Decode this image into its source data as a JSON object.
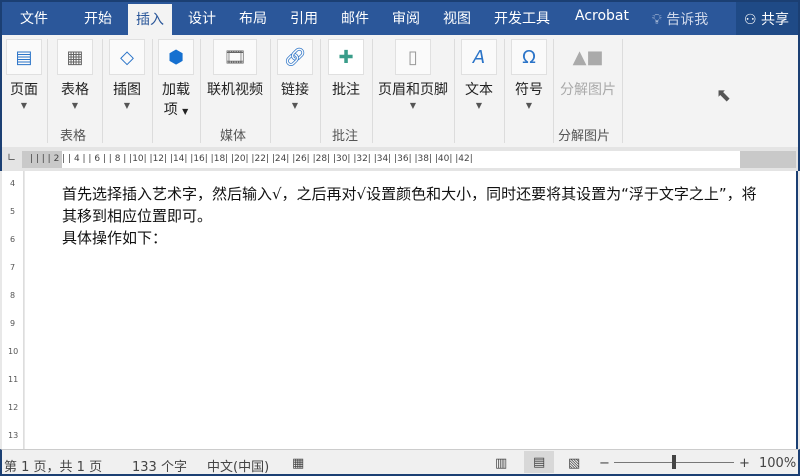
{
  "tabs": [
    "文件",
    "开始",
    "插入",
    "设计",
    "布局",
    "引用",
    "邮件",
    "审阅",
    "视图",
    "开发工具",
    "Acrobat"
  ],
  "tell_me": "告诉我",
  "share": "共享",
  "ribbon": {
    "buttons": [
      {
        "label": "页面"
      },
      {
        "label": "表格"
      },
      {
        "label": "插图"
      },
      {
        "label": "加载",
        "label2": "项"
      },
      {
        "label": "联机视频"
      },
      {
        "label": "链接"
      },
      {
        "label": "批注"
      },
      {
        "label": "页眉和页脚"
      },
      {
        "label": "文本"
      },
      {
        "label": "符号"
      },
      {
        "label": "分解图片"
      }
    ],
    "groups": [
      "表格",
      "媒体",
      "批注",
      "分解图片"
    ]
  },
  "ruler": {
    "ticks": "|   |  |  |  2 |  | 4 |  | 6 |  | 8 |  |10|  |12|  |14|  |16|  |18|  |20|  |22|  |24|  |26|  |28|  |30|  |32|  |34|  |36|  |38|  |40|  |42|"
  },
  "vruler": [
    "4",
    "5",
    "6",
    "7",
    "8",
    "9",
    "10",
    "11",
    "12",
    "13"
  ],
  "document": {
    "lines": [
      "首先选择插入艺术字，然后输入√，之后再对√设置颜色和大小，同时还要将其设置为“浮于文字之上”，将其移到相应位置即可。",
      "具体操作如下："
    ]
  },
  "status": {
    "page": "第 1 页，共 1 页",
    "words": "133 个字",
    "lang": "中文(中国)",
    "zoom": "100%"
  }
}
